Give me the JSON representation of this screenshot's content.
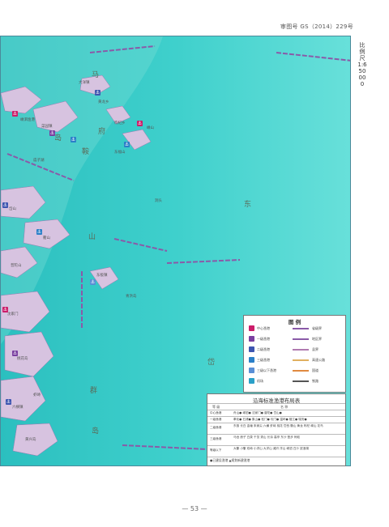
{
  "header": {
    "approval_number": "审图号 GS（2014）229号"
  },
  "scale_text": "比例尺 1:650 000",
  "map": {
    "region_labels": [
      {
        "text": "马"
      },
      {
        "text": "鞍"
      },
      {
        "text": "府"
      },
      {
        "text": "岛"
      },
      {
        "text": "东"
      },
      {
        "text": "山"
      },
      {
        "text": "群"
      },
      {
        "text": "岛"
      },
      {
        "text": "岱"
      }
    ],
    "places": [
      {
        "text": "嵊泗渔港"
      },
      {
        "text": "大洋镇"
      },
      {
        "text": "黄龙乡"
      },
      {
        "text": "菜园镇"
      },
      {
        "text": "嵊山"
      },
      {
        "text": "枸杞乡"
      },
      {
        "text": "岱山"
      },
      {
        "text": "衢山"
      },
      {
        "text": "东极镇"
      },
      {
        "text": "普陀山"
      },
      {
        "text": "沈家门"
      },
      {
        "text": "桃花岛"
      },
      {
        "text": "六横镇"
      },
      {
        "text": "虾峙"
      },
      {
        "text": "黄兴岛"
      },
      {
        "text": "洞头"
      },
      {
        "text": "青浜岛"
      },
      {
        "text": "庙子湖"
      },
      {
        "text": "东福山"
      }
    ]
  },
  "legend": {
    "title": "图 例",
    "items": [
      {
        "label": "中心渔港",
        "color": "#cc1d6a",
        "kind": "port"
      },
      {
        "label": "一级渔港",
        "color": "#7a3fa0",
        "kind": "port"
      },
      {
        "label": "二级渔港",
        "color": "#3d55b0",
        "kind": "port"
      },
      {
        "label": "三级渔港",
        "color": "#2a7fc8",
        "kind": "port"
      },
      {
        "label": "三级以下渔港",
        "color": "#5a8fd6",
        "kind": "port"
      },
      {
        "label": "机场",
        "color": "#2aa0c8",
        "kind": "port"
      },
      {
        "label": "省级界",
        "color": "#8a5aa8",
        "kind": "line"
      },
      {
        "label": "地区界",
        "color": "#8a5aa8",
        "kind": "line"
      },
      {
        "label": "县界",
        "color": "#b07ab0",
        "kind": "line"
      },
      {
        "label": "高速公路",
        "color": "#e0b060",
        "kind": "line"
      },
      {
        "label": "国道",
        "color": "#e08a40",
        "kind": "line"
      },
      {
        "label": "铁路",
        "color": "#555555",
        "kind": "line"
      }
    ]
  },
  "table": {
    "title": "沿海标准渔港布局表",
    "col_headers": [
      "等 级",
      "名 称"
    ],
    "rows": [
      {
        "grade": "中心渔港",
        "names": "舟山● 嵊泗● 沈家门● 普陀● 岱山●"
      },
      {
        "grade": "一级渔港",
        "names": "奉化● 石浦● 象山● 松门● 坎门● 温岭● 椒江● 瑞安●"
      },
      {
        "grade": "二级渔港",
        "names": "东极 长白 金塘 朱家尖 六横 虾峙 桃花 岱西 衢山 黄龙 枸杞 嵊山 花鸟"
      },
      {
        "grade": "三级渔港",
        "names": "马岙 册子 白泉 干览 秀山 长涂 高亭 东沙 登步 蚂蚁"
      },
      {
        "grade": "等级以下",
        "names": "大衢 小衢 双峙 小洋山 大洋山 滩浒 洋山 嵊泗 白沙 鼠浪湖"
      }
    ],
    "note": "●已建设渔港 ▲规划新建渔港"
  },
  "page_number": "— 53 —",
  "colors": {
    "sea": "#2fcfc4",
    "sea_deep": "#5ed6d2",
    "land": "#c8a8d8",
    "border": "#8a5aa8"
  }
}
